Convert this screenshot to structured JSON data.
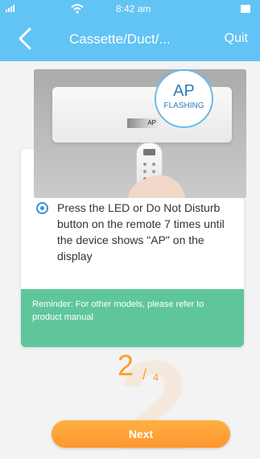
{
  "status_bar": {
    "time": "8:42 am",
    "signal": "signal-icon",
    "wifi": "wifi-icon",
    "battery": "battery-icon"
  },
  "nav": {
    "title": "Cassette/Duct/...",
    "quit": "Quit",
    "back_icon": "chevron-left-icon"
  },
  "illustration": {
    "display_text": "AP",
    "bubble_title": "AP",
    "bubble_subtitle": "FLASHING"
  },
  "instruction": {
    "text": "Press the LED or Do Not Disturb button on the remote 7 times until the device shows \"AP\" on the display"
  },
  "reminder": {
    "text": "Reminder: For other models, please refer to product manual"
  },
  "page_indicator": {
    "current": "2",
    "slash": "/",
    "total": "4",
    "watermark": "2"
  },
  "actions": {
    "next": "Next"
  },
  "colors": {
    "header": "#62c3f5",
    "accent": "#ff9b31",
    "reminder": "#5fc69b",
    "radio": "#3d8ddf"
  }
}
